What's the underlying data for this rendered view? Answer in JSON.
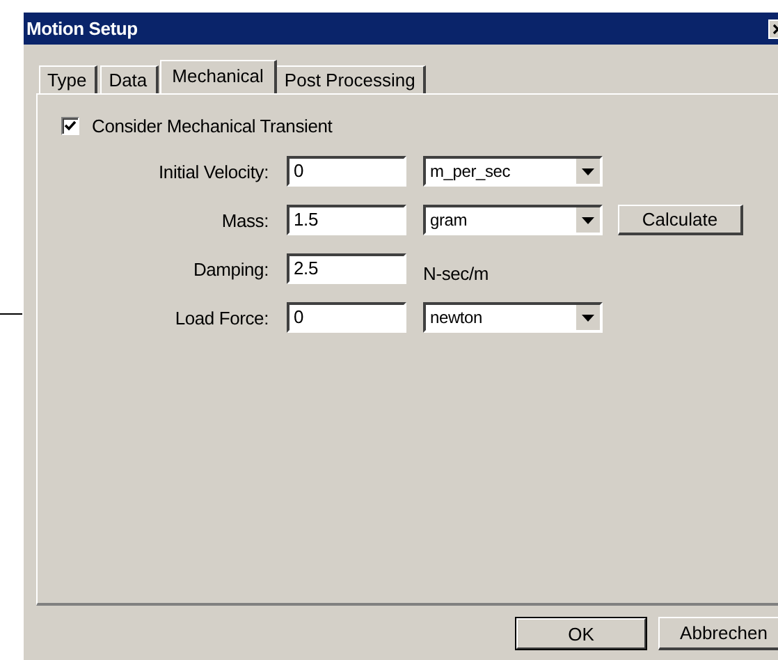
{
  "window": {
    "title": "Motion Setup"
  },
  "tabs": [
    {
      "label": "Type",
      "selected": false
    },
    {
      "label": "Data",
      "selected": false
    },
    {
      "label": "Mechanical",
      "selected": true
    },
    {
      "label": "Post Processing",
      "selected": false
    }
  ],
  "consider_transient": {
    "label": "Consider Mechanical Transient",
    "checked": true
  },
  "fields": [
    {
      "label": "Initial Velocity:",
      "value": "0",
      "kind": "dropdown",
      "unit": "m_per_sec"
    },
    {
      "label": "Mass:",
      "value": "1.5",
      "kind": "dropdown",
      "unit": "gram",
      "button": "Calculate"
    },
    {
      "label": "Damping:",
      "value": "2.5",
      "kind": "text",
      "unit": "N-sec/m"
    },
    {
      "label": "Load Force:",
      "value": "0",
      "kind": "dropdown",
      "unit": "newton"
    }
  ],
  "buttons": [
    {
      "label": "OK",
      "default": true
    },
    {
      "label": "Abbrechen",
      "default": false
    }
  ]
}
